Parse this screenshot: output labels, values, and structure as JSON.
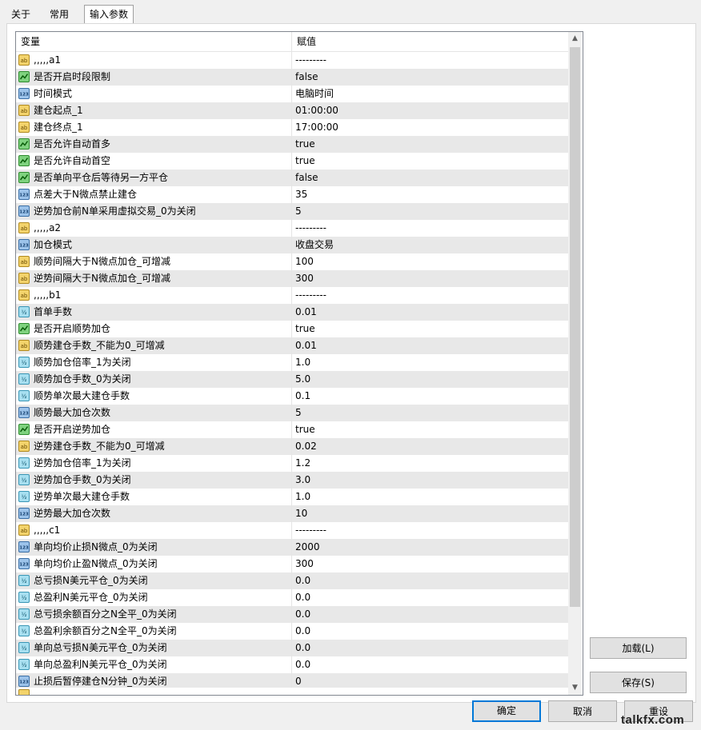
{
  "tabs": [
    {
      "label": "关于"
    },
    {
      "label": "常用"
    },
    {
      "label": "输入参数",
      "active": true
    }
  ],
  "grid": {
    "columns": {
      "variable": "变量",
      "value": "赋值"
    },
    "rows": [
      {
        "icon": "ab",
        "name": ",,,,,a1",
        "value": "---------"
      },
      {
        "icon": "bool",
        "name": "是否开启时段限制",
        "value": "false"
      },
      {
        "icon": "123",
        "name": "时间模式",
        "value": "电脑时间"
      },
      {
        "icon": "ab",
        "name": "建仓起点_1",
        "value": "01:00:00"
      },
      {
        "icon": "ab",
        "name": "建仓终点_1",
        "value": "17:00:00"
      },
      {
        "icon": "bool",
        "name": "是否允许自动首多",
        "value": "true"
      },
      {
        "icon": "bool",
        "name": "是否允许自动首空",
        "value": "true"
      },
      {
        "icon": "bool",
        "name": "是否单向平仓后等待另一方平仓",
        "value": "false"
      },
      {
        "icon": "123",
        "name": "点差大于N微点禁止建仓",
        "value": "35"
      },
      {
        "icon": "123",
        "name": "逆势加仓前N单采用虚拟交易_0为关闭",
        "value": "5"
      },
      {
        "icon": "ab",
        "name": ",,,,,a2",
        "value": "---------"
      },
      {
        "icon": "123",
        "name": "加仓模式",
        "value": "收盘交易"
      },
      {
        "icon": "ab",
        "name": "顺势间隔大于N微点加仓_可增减",
        "value": "100"
      },
      {
        "icon": "ab",
        "name": "逆势间隔大于N微点加仓_可增减",
        "value": "300"
      },
      {
        "icon": "ab",
        "name": ",,,,,b1",
        "value": "---------"
      },
      {
        "icon": "half",
        "name": "首单手数",
        "value": "0.01"
      },
      {
        "icon": "bool",
        "name": "是否开启顺势加仓",
        "value": "true"
      },
      {
        "icon": "ab",
        "name": "顺势建仓手数_不能为0_可增减",
        "value": "0.01"
      },
      {
        "icon": "half",
        "name": "顺势加仓倍率_1为关闭",
        "value": "1.0"
      },
      {
        "icon": "half",
        "name": "顺势加仓手数_0为关闭",
        "value": "5.0"
      },
      {
        "icon": "half",
        "name": "顺势单次最大建仓手数",
        "value": "0.1"
      },
      {
        "icon": "123",
        "name": "顺势最大加仓次数",
        "value": "5"
      },
      {
        "icon": "bool",
        "name": "是否开启逆势加仓",
        "value": "true"
      },
      {
        "icon": "ab",
        "name": "逆势建仓手数_不能为0_可增减",
        "value": "0.02"
      },
      {
        "icon": "half",
        "name": "逆势加仓倍率_1为关闭",
        "value": "1.2"
      },
      {
        "icon": "half",
        "name": "逆势加仓手数_0为关闭",
        "value": "3.0"
      },
      {
        "icon": "half",
        "name": "逆势单次最大建仓手数",
        "value": "1.0"
      },
      {
        "icon": "123",
        "name": "逆势最大加仓次数",
        "value": "10"
      },
      {
        "icon": "ab",
        "name": ",,,,,c1",
        "value": "---------"
      },
      {
        "icon": "123",
        "name": "单向均价止损N微点_0为关闭",
        "value": "2000"
      },
      {
        "icon": "123",
        "name": "单向均价止盈N微点_0为关闭",
        "value": "300"
      },
      {
        "icon": "half",
        "name": "总亏损N美元平仓_0为关闭",
        "value": "0.0"
      },
      {
        "icon": "half",
        "name": "总盈利N美元平仓_0为关闭",
        "value": "0.0"
      },
      {
        "icon": "half",
        "name": "总亏损余额百分之N全平_0为关闭",
        "value": "0.0"
      },
      {
        "icon": "half",
        "name": "总盈利余额百分之N全平_0为关闭",
        "value": "0.0"
      },
      {
        "icon": "half",
        "name": "单向总亏损N美元平仓_0为关闭",
        "value": "0.0"
      },
      {
        "icon": "half",
        "name": "单向总盈利N美元平仓_0为关闭",
        "value": "0.0"
      },
      {
        "icon": "123",
        "name": "止损后暂停建仓N分钟_0为关闭",
        "value": "0"
      }
    ]
  },
  "buttons": {
    "load": "加载(L)",
    "save": "保存(S)",
    "ok": "确定",
    "cancel": "取消",
    "reset": "重设"
  },
  "watermark": "talkfx.com",
  "colors": {
    "accent": "#0078d7",
    "row_alt": "#e8e8e8"
  }
}
